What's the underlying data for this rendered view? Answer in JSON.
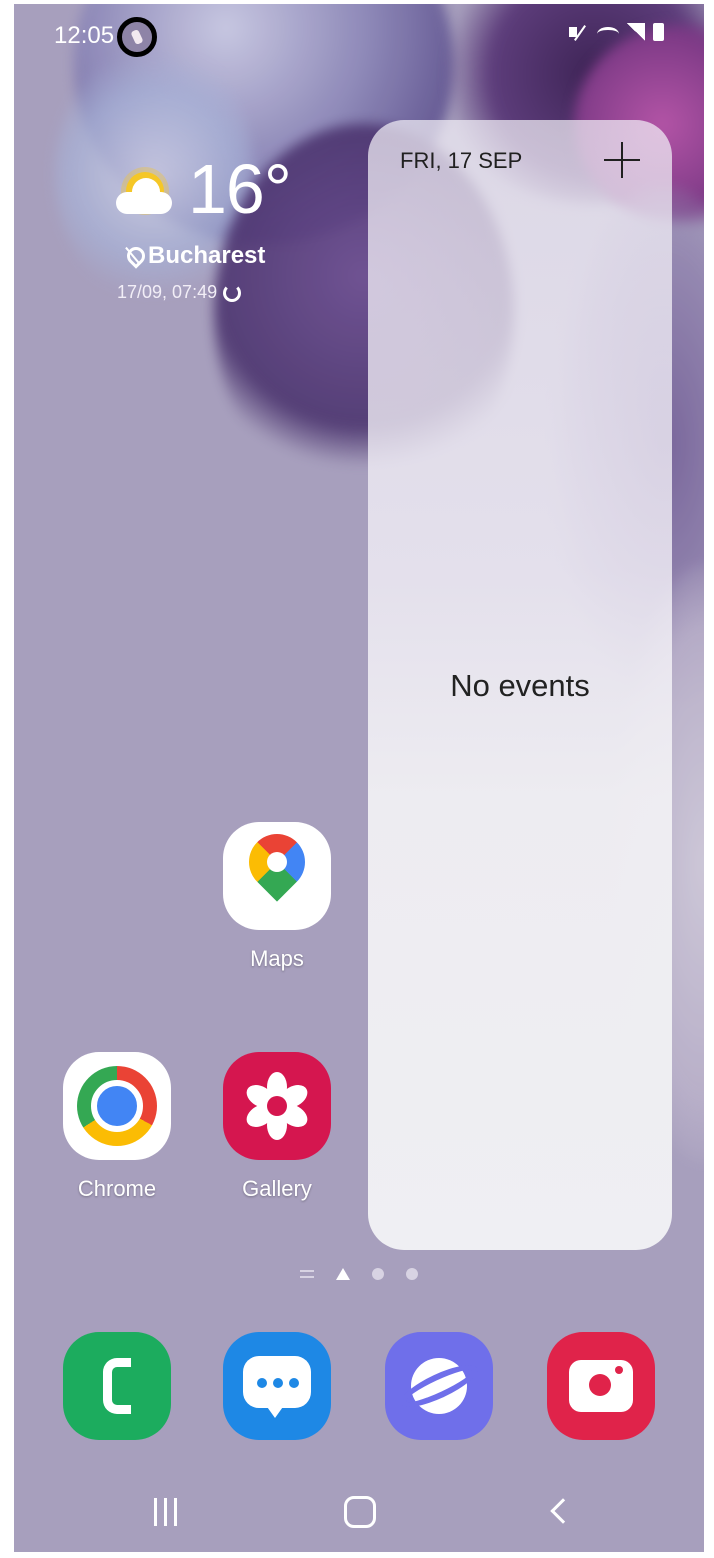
{
  "status_bar": {
    "time": "12:05",
    "notification_icon": "app-notification-icon",
    "icons": [
      "mute-icon",
      "wifi-icon",
      "signal-icon",
      "battery-icon"
    ]
  },
  "weather": {
    "temperature": "16°",
    "location": "Bucharest",
    "updated": "17/09, 07:49",
    "condition_icon": "partly-sunny-icon"
  },
  "calendar": {
    "date": "FRI, 17 SEP",
    "empty_text": "No events",
    "add_icon": "plus-icon"
  },
  "apps": {
    "maps": "Maps",
    "chrome": "Chrome",
    "gallery": "Gallery"
  },
  "dock": [
    "phone-icon",
    "messages-icon",
    "internet-icon",
    "camera-icon"
  ],
  "page_indicator": {
    "pages": 3,
    "current": "home"
  },
  "nav_bar": [
    "recent-apps-icon",
    "home-icon",
    "back-icon"
  ],
  "colors": {
    "wallpaper": "#a79fbd",
    "gallery": "#d5164f",
    "phone": "#1cac5e",
    "messages": "#1e88e5",
    "internet": "#6f6fea",
    "camera": "#e0234a"
  }
}
